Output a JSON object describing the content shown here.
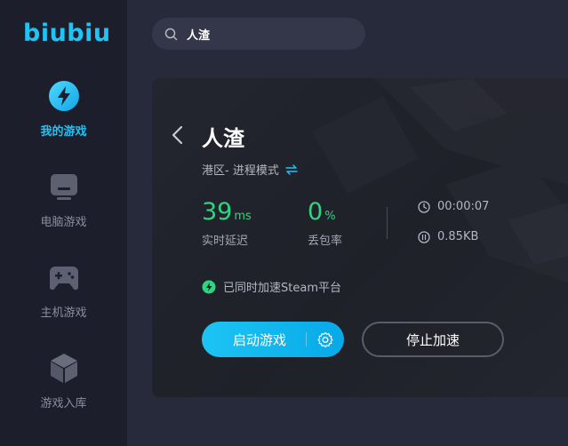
{
  "app": {
    "logo_text": "biubiu"
  },
  "sidebar": {
    "items": [
      {
        "label": "我的游戏",
        "icon": "lightning-icon",
        "active": true
      },
      {
        "label": "电脑游戏",
        "icon": "monitor-icon",
        "active": false
      },
      {
        "label": "主机游戏",
        "icon": "gamepad-icon",
        "active": false
      },
      {
        "label": "游戏入库",
        "icon": "box-icon",
        "active": false
      }
    ]
  },
  "search": {
    "value": "人渣",
    "icon": "search-icon"
  },
  "game": {
    "title": "人渣",
    "mode_text": "港区- 进程模式",
    "latency_value": "39",
    "latency_unit": "ms",
    "latency_label": "实时延迟",
    "loss_value": "0",
    "loss_unit": "%",
    "loss_label": "丢包率",
    "duration": "00:00:07",
    "traffic": "0.85KB",
    "steam_text": "已同时加速Steam平台"
  },
  "actions": {
    "start_label": "启动游戏",
    "stop_label": "停止加速"
  },
  "colors": {
    "accent": "#20c3f5",
    "success": "#2ed57f",
    "sidebar_bg": "#1c1e2b",
    "main_bg": "#272a3a"
  }
}
